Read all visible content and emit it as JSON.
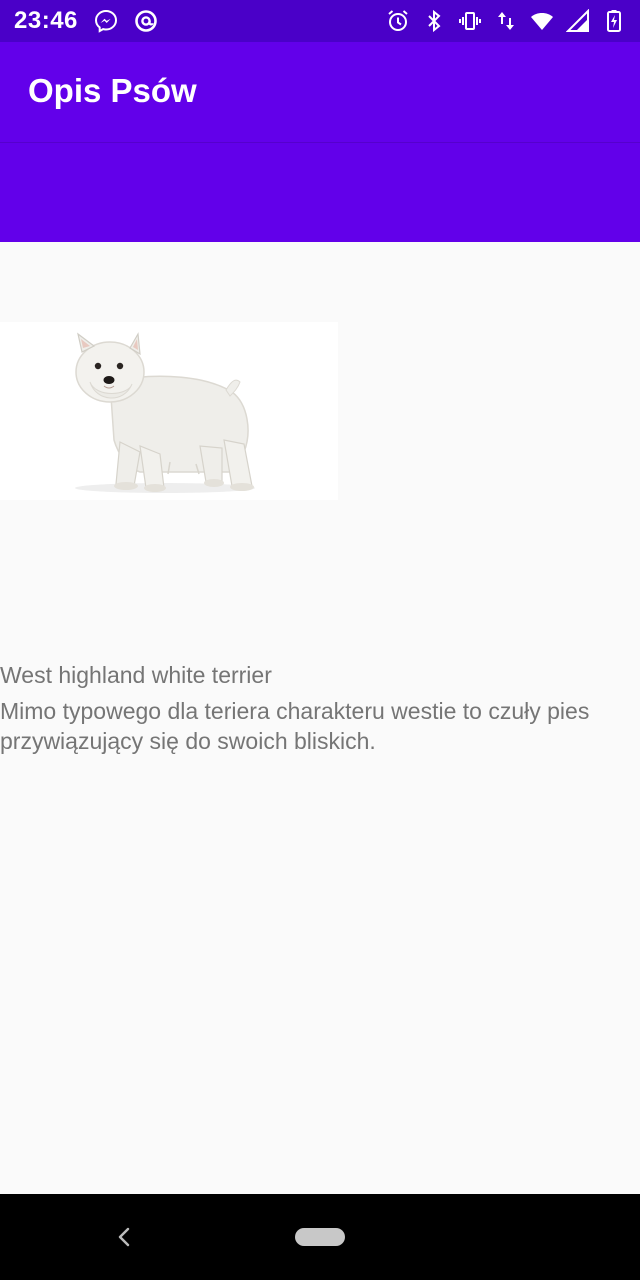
{
  "status_bar": {
    "time": "23:46",
    "left_icons": [
      "messenger-icon",
      "at-sign-icon"
    ],
    "right_icons": [
      "alarm-icon",
      "bluetooth-icon",
      "vibrate-icon",
      "data-arrows-icon",
      "wifi-icon",
      "cell-signal-icon",
      "battery-charging-icon"
    ]
  },
  "app_bar": {
    "title": "Opis Psów",
    "color": "#6200ea",
    "status_color": "#4a00c8"
  },
  "content": {
    "image": "dog-photo",
    "breed_name": "West highland white terrier",
    "description": "Mimo typowego dla teriera charakteru westie to czuły pies przywiązujący się do swoich bliskich."
  },
  "nav_bar": {
    "icons": [
      "back-icon",
      "home-pill-icon"
    ]
  }
}
